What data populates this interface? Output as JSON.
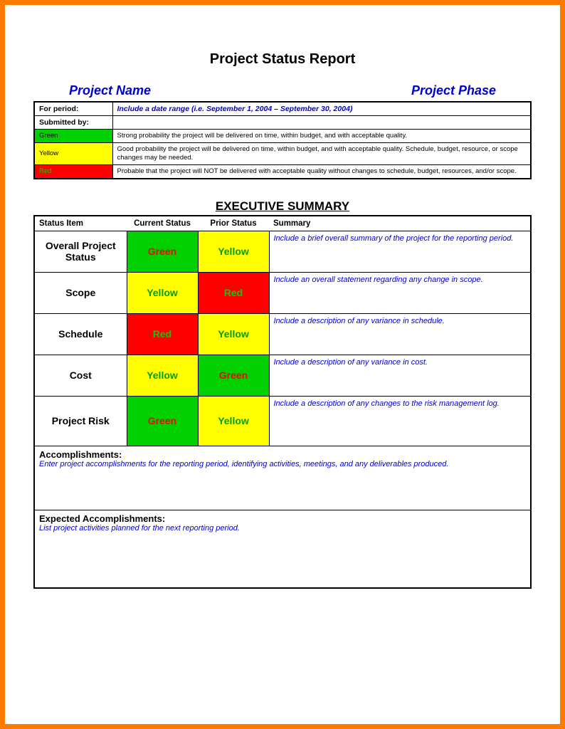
{
  "title": "Project Status Report",
  "header": {
    "project_name_label": "Project Name",
    "project_phase_label": "Project Phase"
  },
  "info": {
    "period_label": "For period:",
    "period_value": "Include a date range (i.e. September 1, 2004 – September 30, 2004)",
    "submitted_label": "Submitted by:",
    "submitted_value": ""
  },
  "legend": [
    {
      "name": "Green",
      "desc": "Strong probability the project will be delivered on time, within budget, and with acceptable quality."
    },
    {
      "name": "Yellow",
      "desc": "Good probability the project will be delivered on time, within budget, and with acceptable quality. Schedule, budget, resource, or scope changes may be needed."
    },
    {
      "name": "Red",
      "desc": "Probable that the project will NOT be delivered with acceptable quality without changes to schedule, budget, resources, and/or scope."
    }
  ],
  "executive_title": "EXECUTIVE SUMMARY",
  "columns": {
    "c1": "Status Item",
    "c2": "Current Status",
    "c3": "Prior Status",
    "c4": "Summary"
  },
  "rows": [
    {
      "item": "Overall Project Status",
      "current": "Green",
      "prior": "Yellow",
      "summary": "Include a brief overall summary of the project for the reporting period."
    },
    {
      "item": "Scope",
      "current": "Yellow",
      "prior": "Red",
      "summary": "Include an overall statement regarding any change in scope."
    },
    {
      "item": "Schedule",
      "current": "Red",
      "prior": "Yellow",
      "summary": "Include a description of any variance in schedule."
    },
    {
      "item": "Cost",
      "current": "Yellow",
      "prior": "Green",
      "summary": "Include a description of any variance in cost."
    },
    {
      "item": "Project Risk",
      "current": "Green",
      "prior": "Yellow",
      "summary": "Include a description of any changes to the risk management log."
    }
  ],
  "sections": {
    "accomplishments_label": "Accomplishments:",
    "accomplishments_text": "Enter project accomplishments for the reporting period, identifying activities, meetings, and any deliverables produced.",
    "expected_label": "Expected Accomplishments:",
    "expected_text": "List project activities planned for the next reporting period."
  }
}
